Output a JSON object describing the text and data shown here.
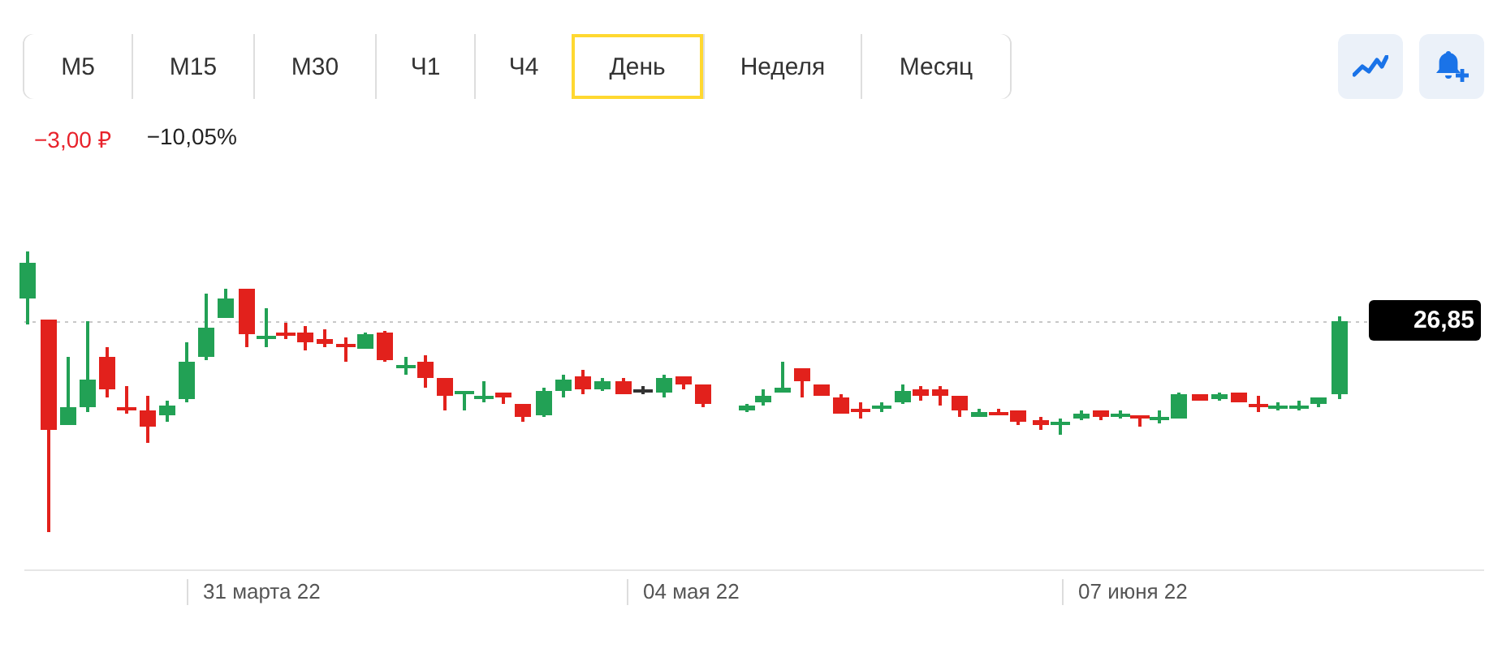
{
  "timeframe_tabs": [
    {
      "label": "M5",
      "selected": false
    },
    {
      "label": "M15",
      "selected": false
    },
    {
      "label": "M30",
      "selected": false
    },
    {
      "label": "Ч1",
      "selected": false
    },
    {
      "label": "Ч4",
      "selected": false
    },
    {
      "label": "День",
      "selected": true
    },
    {
      "label": "Неделя",
      "selected": false
    },
    {
      "label": "Месяц",
      "selected": false
    }
  ],
  "change": [
    {
      "text": "−3,00 ₽",
      "color": "#e8222b"
    },
    {
      "text": "−10,05%",
      "color": "#222222"
    }
  ],
  "chart": {
    "last_price": "26,85",
    "x_labels": [
      "31 марта 22",
      "04 мая 22",
      "07 июня 22"
    ]
  }
}
